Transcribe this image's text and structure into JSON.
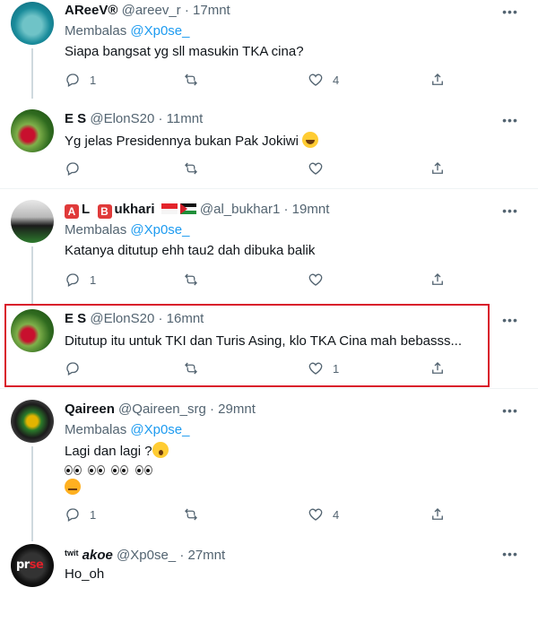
{
  "labels": {
    "replying_to": "Membalas",
    "views": ""
  },
  "tweets": [
    {
      "id": "t1",
      "display_name": "AReeV®",
      "handle": "@areev_r",
      "time": "17mnt",
      "reply_to_handle": "@Xp0se_",
      "text": "Siapa bangsat yg sll masukin TKA cina?",
      "replies": "1",
      "retweets": "",
      "likes": "4",
      "avatar": "sea-avatar"
    },
    {
      "id": "t2",
      "display_name": "E S",
      "handle": "@ElonS20",
      "time": "11mnt",
      "text": "Yg jelas Presidennya bukan Pak Jokiwi",
      "emoji": "laughing-emoji",
      "replies": "",
      "retweets": "",
      "likes": "",
      "avatar": "strawberry-avatar"
    },
    {
      "id": "t3",
      "display_name_a": "A",
      "display_name_l": "L",
      "display_name_b": "B",
      "display_name_rest": "ukhari",
      "handle": "@al_bukhar1",
      "time": "19mnt",
      "reply_to_handle": "@Xp0se_",
      "text": "Katanya ditutup ehh tau2 dah dibuka balik",
      "replies": "1",
      "retweets": "",
      "likes": "",
      "avatar": "flag-avatar"
    },
    {
      "id": "t4",
      "display_name": "E S",
      "handle": "@ElonS20",
      "time": "16mnt",
      "text": "Ditutup itu untuk TKI dan Turis Asing, klo TKA Cina mah bebasss...",
      "replies": "",
      "retweets": "",
      "likes": "1",
      "avatar": "strawberry-avatar"
    },
    {
      "id": "t5",
      "display_name": "Qaireen",
      "handle": "@Qaireen_srg",
      "time": "29mnt",
      "reply_to_handle": "@Xp0se_",
      "text": "Lagi dan lagi ?",
      "replies": "1",
      "retweets": "",
      "likes": "4",
      "avatar": "emblem-avatar"
    },
    {
      "id": "t6",
      "display_name_prefix": "twit",
      "display_name": "akoe",
      "handle": "@Xp0se_",
      "time": "27mnt",
      "text": "Ho_oh",
      "avatar": "pr-avatar",
      "avatar_text_1": "pr",
      "avatar_text_2": "se"
    }
  ],
  "sep": "·",
  "colors": {
    "accent": "#1d9bf0",
    "muted": "#536471",
    "highlight_border": "#d9182b"
  }
}
